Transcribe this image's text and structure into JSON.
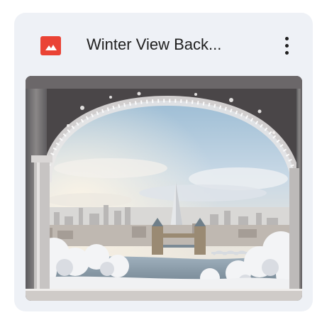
{
  "file_card": {
    "title": "Winter View Back...",
    "icons": {
      "file_type": "image-file-icon",
      "menu": "more-vert-icon"
    },
    "colors": {
      "card_background": "#eef1f6",
      "file_type_icon": "#ea4335",
      "title_text": "#1f1f1f"
    }
  }
}
